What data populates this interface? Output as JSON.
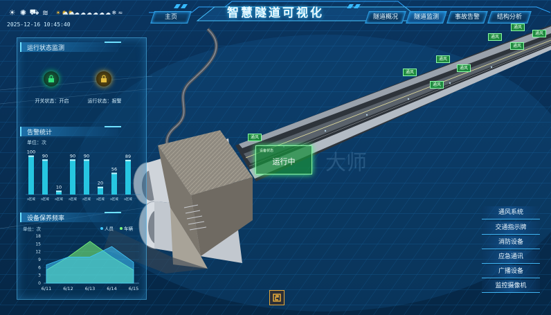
{
  "header": {
    "title": "智慧隧道可视化",
    "home_label": "主页",
    "nav": [
      "隧道概况",
      "隧道监测",
      "事故告警",
      "结构分析"
    ],
    "active_nav": "隧道监测",
    "datetime": "2025-12-16 10:45:40"
  },
  "weather": {
    "main": [
      "sun",
      "gear-sun",
      "car",
      "wind"
    ],
    "forecast": [
      "sun",
      "sun-cloud",
      "sun-cloud",
      "cloud",
      "cloud",
      "rain-cloud",
      "rain-cloud",
      "rain-cloud",
      "snow-cloud",
      "snowflake",
      "wind"
    ]
  },
  "run_status": {
    "title": "运行状态监测",
    "switch_label": "开关状态：开启",
    "run_label": "运行状态：报警",
    "switch_color": "#1fd36a",
    "run_color": "#d9b23a"
  },
  "alarm_stats": {
    "title": "告警统计",
    "unit": "单位：次"
  },
  "maintenance": {
    "title": "设备保养频率",
    "unit": "单位：次"
  },
  "tunnel": {
    "signs": [
      "通风",
      "通风",
      "通风",
      "通风",
      "通风",
      "通风",
      "通风",
      "通风",
      "通风"
    ],
    "status_small": "设备状态",
    "status_big": "运行中",
    "watermark": "大师"
  },
  "right_menu": [
    "通风系统",
    "交通指示牌",
    "消防设备",
    "应急通讯",
    "广播设备",
    "监控摄像机"
  ],
  "colors": {
    "accent": "#2fa8ff",
    "bar": "#2ad6f0",
    "series_people": "#3fc7ff",
    "series_vehicle": "#7dff7a"
  },
  "chart_data": [
    {
      "type": "bar",
      "title": "告警统计",
      "ylabel": "单位：次",
      "categories": [
        "a区域",
        "a区域",
        "a区域",
        "a区域",
        "a区域",
        "a区域",
        "a区域",
        "a区域"
      ],
      "values": [
        100,
        90,
        10,
        90,
        90,
        20,
        56,
        89
      ],
      "ylim": [
        0,
        110
      ]
    },
    {
      "type": "area",
      "title": "设备保养频率",
      "ylabel": "单位：次",
      "x": [
        "6/11",
        "6/12",
        "6/13",
        "6/14",
        "6/15"
      ],
      "yticks": [
        0,
        3,
        6,
        9,
        12,
        15,
        18
      ],
      "ylim": [
        0,
        18
      ],
      "legend_position": "top-right",
      "series": [
        {
          "name": "人员",
          "values": [
            7,
            10,
            10,
            14,
            8
          ]
        },
        {
          "name": "车辆",
          "values": [
            5,
            10,
            16,
            10,
            5
          ]
        }
      ]
    }
  ]
}
